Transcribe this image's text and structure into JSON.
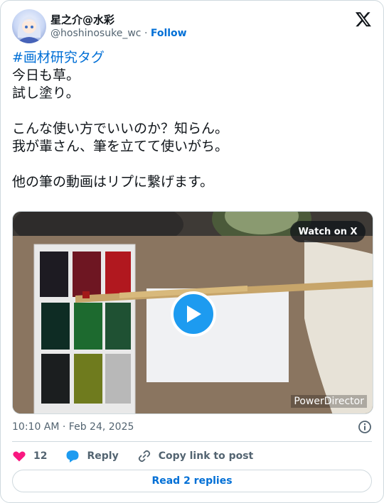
{
  "author": {
    "display_name": "星之介@水彩",
    "handle": "@hoshinosuke_wc",
    "separator": "·",
    "follow_label": "Follow"
  },
  "tweet": {
    "hashtag": "#画材研究タグ",
    "body": "今日も草。\n試し塗り。\n\nこんな使い方でいいのか？知らん。\n我が輩さん、筆を立てて使いがち。\n\n他の筆の動画はリプに繋げます。"
  },
  "media": {
    "watch_label": "Watch on X",
    "watermark": "PowerDirector"
  },
  "meta": {
    "timestamp": "10:10 AM · Feb 24, 2025"
  },
  "actions": {
    "like_count": "12",
    "reply_label": "Reply",
    "copy_label": "Copy link to post"
  },
  "read_replies_label": "Read 2 replies",
  "icons": [
    "x-logo-icon",
    "heart-icon",
    "reply-bubble-icon",
    "link-icon",
    "info-icon",
    "play-icon"
  ],
  "colors": {
    "accent": "#006fd6",
    "like": "#f91880",
    "reply": "#1d9bf0",
    "secondary_text": "#536471",
    "border": "#cfd9de"
  }
}
